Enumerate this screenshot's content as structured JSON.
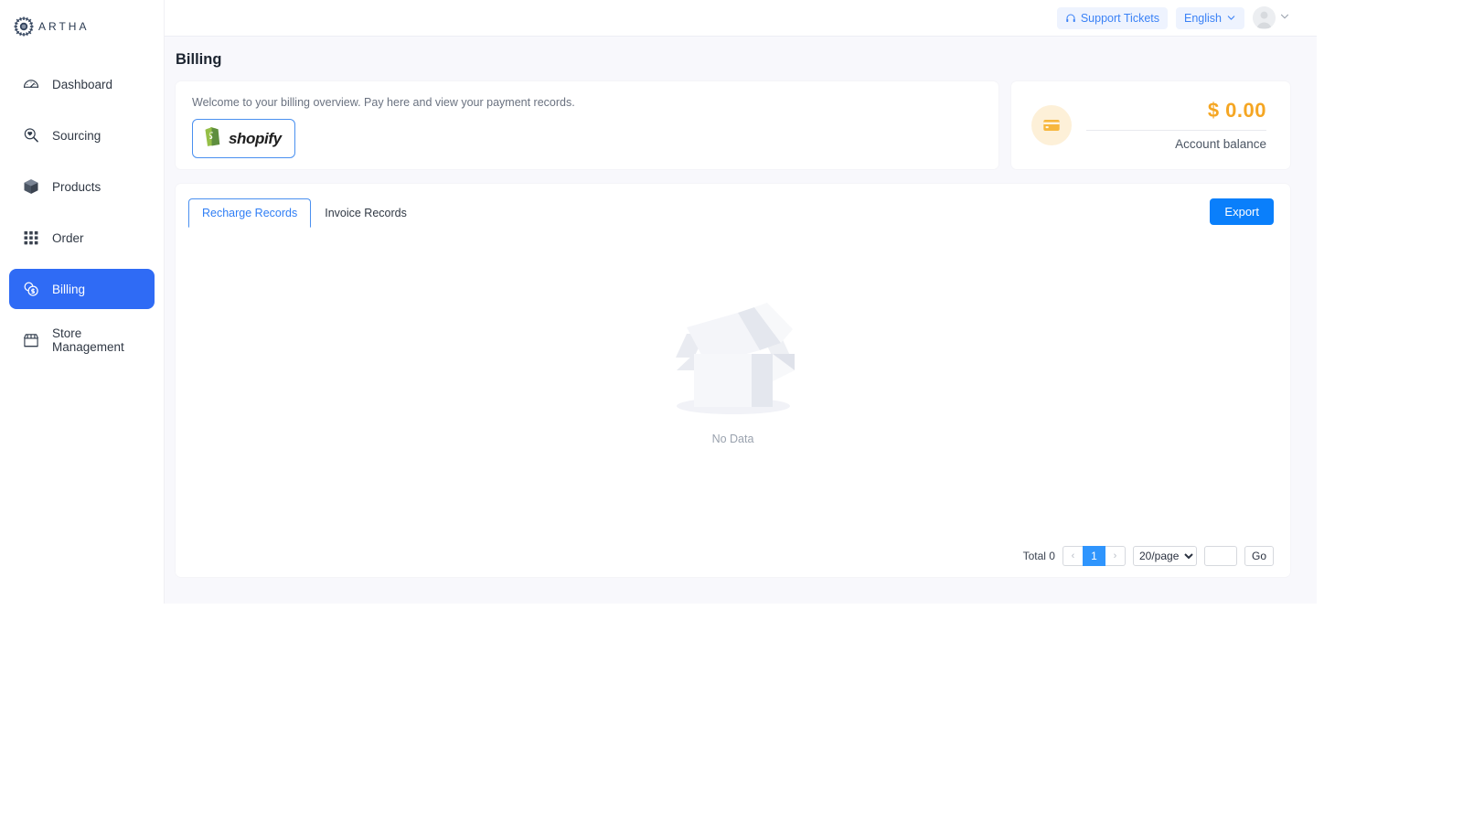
{
  "brand": {
    "name": "ARTHA",
    "logo_icon": "mandala-gear-icon"
  },
  "sidebar": {
    "items": [
      {
        "label": "Dashboard",
        "icon": "speedometer-icon",
        "active": false
      },
      {
        "label": "Sourcing",
        "icon": "search-heart-icon",
        "active": false
      },
      {
        "label": "Products",
        "icon": "box-icon",
        "active": false
      },
      {
        "label": "Order",
        "icon": "grid-dots-icon",
        "active": false
      },
      {
        "label": "Billing",
        "icon": "coins-dollar-icon",
        "active": true
      },
      {
        "label": "Store Management",
        "icon": "storefront-icon",
        "active": false
      }
    ]
  },
  "header": {
    "support_label": "Support Tickets",
    "support_icon": "headset-icon",
    "language_label": "English",
    "language_chevron": "chevron-down-icon",
    "avatar_icon": "user-avatar-icon",
    "avatar_chevron": "chevron-down-icon"
  },
  "page": {
    "title": "Billing"
  },
  "welcome": {
    "text": "Welcome to your billing overview. Pay here and view your payment records.",
    "shopify_label": "shopify",
    "shopify_icon": "shopify-bag-icon"
  },
  "balance": {
    "icon": "credit-card-icon",
    "amount": "$ 0.00",
    "label": "Account balance",
    "accent_color": "#f5a623"
  },
  "records": {
    "tabs": [
      {
        "label": "Recharge Records",
        "active": true
      },
      {
        "label": "Invoice Records",
        "active": false
      }
    ],
    "export_label": "Export",
    "export_color": "#0a7ffb",
    "empty_label": "No Data",
    "empty_icon": "empty-box-icon"
  },
  "pagination": {
    "total_label": "Total 0",
    "prev_icon": "chevron-left-icon",
    "next_icon": "chevron-right-icon",
    "current_page": "1",
    "page_size": "20/page",
    "page_size_options": [
      "20/page"
    ],
    "jump_value": "",
    "go_label": "Go"
  }
}
